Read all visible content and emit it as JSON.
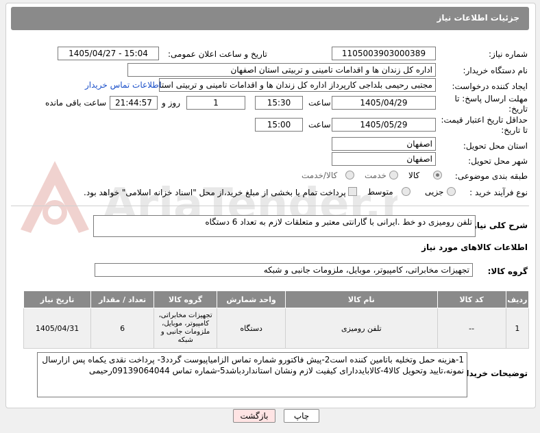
{
  "header": {
    "title": "جزئیات اطلاعات نیاز"
  },
  "fields": {
    "need_number": {
      "label": "شماره نیاز:",
      "value": "1105003903000389"
    },
    "announce": {
      "label": "تاریخ و ساعت اعلان عمومی:",
      "value": "1405/04/27 - 15:04"
    },
    "buyer_org": {
      "label": "نام دستگاه خریدار:",
      "value": "اداره کل زندان ها و اقدامات تامینی و تربیتی استان اصفهان"
    },
    "requester": {
      "label": "ایجاد کننده درخواست:",
      "value": "مجتبی رحیمی بلداجی کارپرداز اداره کل زندان ها و اقدامات تامینی و تربیتی استان",
      "contact_link": "اطلاعات تماس خریدار"
    },
    "reply_deadline": {
      "label_line1": "مهلت ارسال پاسخ: تا",
      "label_line2": "تاریخ:",
      "date": "1405/04/29",
      "time_label": "ساعت",
      "time": "15:30",
      "days": "1",
      "days_label": "روز و",
      "remaining": "21:44:57",
      "remaining_label": "ساعت باقی مانده"
    },
    "price_validity": {
      "label_line1": "حداقل تاریخ اعتبار قیمت:",
      "label_line2": "تا تاریخ:",
      "date": "1405/05/29",
      "time_label": "ساعت",
      "time": "15:00"
    },
    "province": {
      "label": "استان محل تحویل:",
      "value": "اصفهان"
    },
    "city": {
      "label": "شهر محل تحویل:",
      "value": "اصفهان"
    },
    "category": {
      "label": "طبقه بندی موضوعی:",
      "options": [
        "کالا",
        "خدمت",
        "کالا/خدمت"
      ],
      "selected": "کالا"
    },
    "process": {
      "label": "نوع فرآیند خرید :",
      "options": [
        "جزیی",
        "متوسط"
      ],
      "payment_text": "پرداخت تمام یا بخشی از مبلغ خرید،از محل \"اسناد خزانه اسلامی\" خواهد بود."
    }
  },
  "description": {
    "label": "شرح کلی نیاز:",
    "value": "تلفن رومیزی دو خط .ایرانی با گارانتی معتبر و متعلقات لازم به تعداد 6 دستگاه"
  },
  "goods_info": {
    "title": "اطلاعات کالاهای مورد نیاز",
    "group_label": "گروه کالا:",
    "group_value": "تجهیزات مخابراتی، کامپیوتر، موبایل، ملزومات جانبی و شبکه"
  },
  "table": {
    "headers": [
      "ردیف",
      "کد کالا",
      "نام کالا",
      "واحد شمارش",
      "گروه کالا",
      "تعداد / مقدار",
      "تاریخ نیاز"
    ],
    "rows": [
      [
        "1",
        "--",
        "تلفن رومیزی",
        "دستگاه",
        "تجهیزات مخابراتی، کامپیوتر، موبایل، ملزومات جانبی و شبکه",
        "6",
        "1405/04/31"
      ]
    ]
  },
  "buyer_notes": {
    "label": "توضیحات خریدار:",
    "value": "1-هزینه حمل وتخلیه باتامین کننده است2-پیش فاکتورو شماره تماس الزامیاپیوست گردد3- پرداخت نقدی یکماه  پس ازارسال نمونه،تایید وتحویل کالا4-کالابایددارای کیفیت لازم ونشان استانداردباشد5-شماره تماس 09139064044رحیمی"
  },
  "buttons": {
    "print": "چاپ",
    "back": "بازگشت"
  },
  "watermark": {
    "text": "AriaTender.net"
  },
  "colors": {
    "header_bg": "#8a8a8a",
    "link": "#1a4fc9",
    "back_button": "#ffe4e4"
  }
}
